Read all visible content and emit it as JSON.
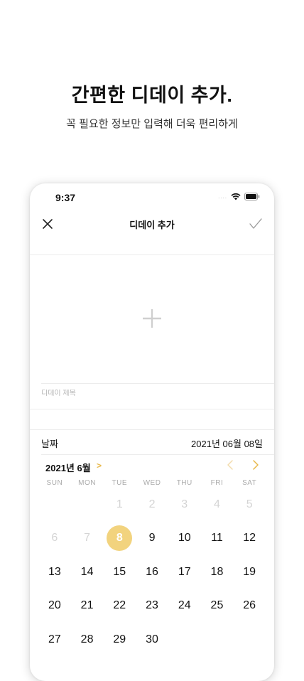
{
  "promo": {
    "headline": "간편한 디데이 추가.",
    "subline": "꼭 필요한 정보만 입력해 더욱 편리하게"
  },
  "status_bar": {
    "time": "9:37",
    "signal": "....",
    "icons": [
      "wifi-icon",
      "battery-icon"
    ]
  },
  "nav": {
    "title": "디데이 추가",
    "left_icon": "close-icon",
    "right_icon": "checkmark-icon"
  },
  "photo": {
    "icon": "plus-icon"
  },
  "title_field": {
    "placeholder": "디데이 제목",
    "value": ""
  },
  "date_row": {
    "label": "날짜",
    "value": "2021년 06월 08일"
  },
  "calendar": {
    "month_label": "2021년 6월",
    "month_chevron": ">",
    "weekdays": [
      "SUN",
      "MON",
      "TUE",
      "WED",
      "THU",
      "FRI",
      "SAT"
    ],
    "rows": [
      [
        "",
        "",
        "1",
        "2",
        "3",
        "4",
        "5"
      ],
      [
        "6",
        "7",
        "8",
        "9",
        "10",
        "11",
        "12"
      ],
      [
        "13",
        "14",
        "15",
        "16",
        "17",
        "18",
        "19"
      ],
      [
        "20",
        "21",
        "22",
        "23",
        "24",
        "25",
        "26"
      ],
      [
        "27",
        "28",
        "29",
        "30",
        "",
        "",
        ""
      ]
    ],
    "selected_day": "8",
    "accent_color": "#f2d37e",
    "chevron_color": "#e8b84a"
  }
}
